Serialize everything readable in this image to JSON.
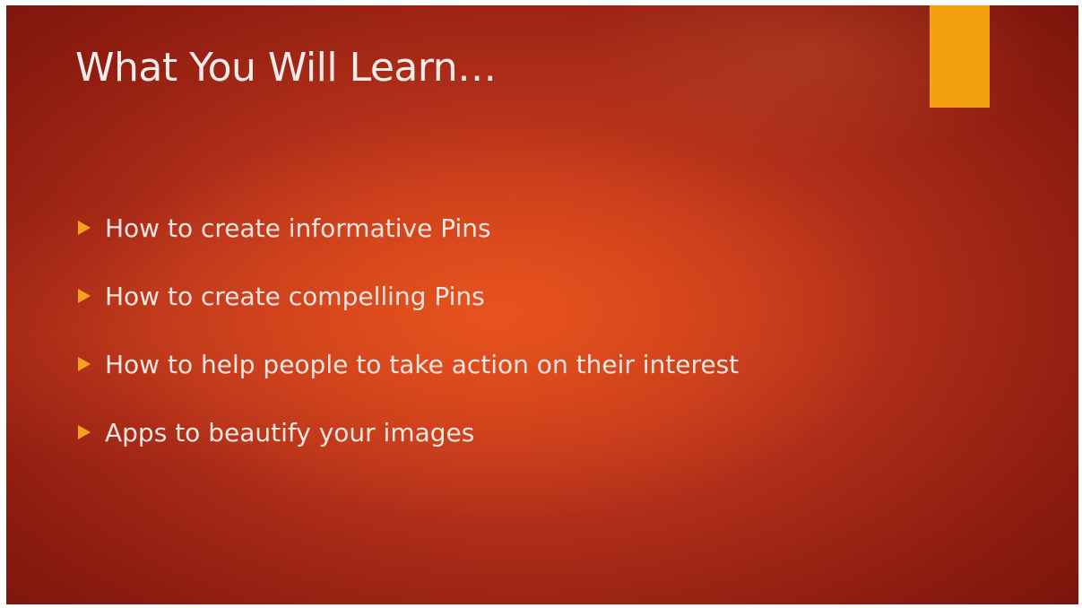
{
  "slide": {
    "title": "What You Will Learn…",
    "accent_color": "#f3a10f",
    "bullet_icon": "triangle-right-icon",
    "bullets": [
      "How to create informative Pins",
      "How to create compelling Pins",
      "How to help people to take action on their interest",
      "Apps to beautify your images"
    ]
  }
}
